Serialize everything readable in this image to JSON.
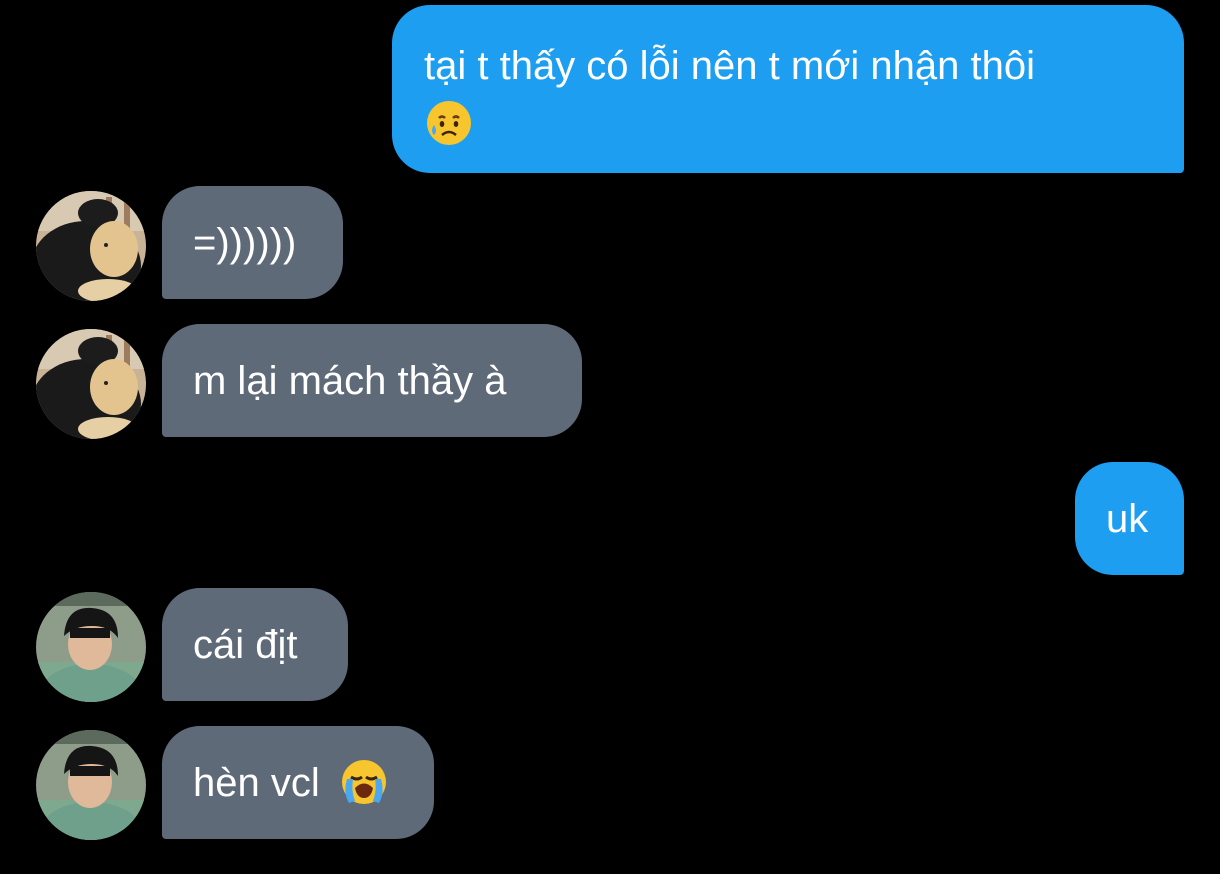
{
  "messages": [
    {
      "side": "out",
      "text": "tại t thấy có lỗi nên t mới nhận thôi",
      "emoji": "sad-but-relieved-face-emoji"
    },
    {
      "side": "in",
      "avatar": "avatar-teddy",
      "text": "=))))))"
    },
    {
      "side": "in",
      "avatar": "avatar-teddy",
      "text": "m lại mách thầy à"
    },
    {
      "side": "out",
      "text": "uk"
    },
    {
      "side": "in",
      "avatar": "avatar-boy",
      "text": "cái địt"
    },
    {
      "side": "in",
      "avatar": "avatar-boy",
      "text": "hèn vcl",
      "emoji": "loudly-crying-face-emoji"
    }
  ],
  "colors": {
    "background": "#000000",
    "outgoing_bubble": "#1d9ef0",
    "incoming_bubble": "#5f6a79",
    "text": "#ffffff"
  }
}
